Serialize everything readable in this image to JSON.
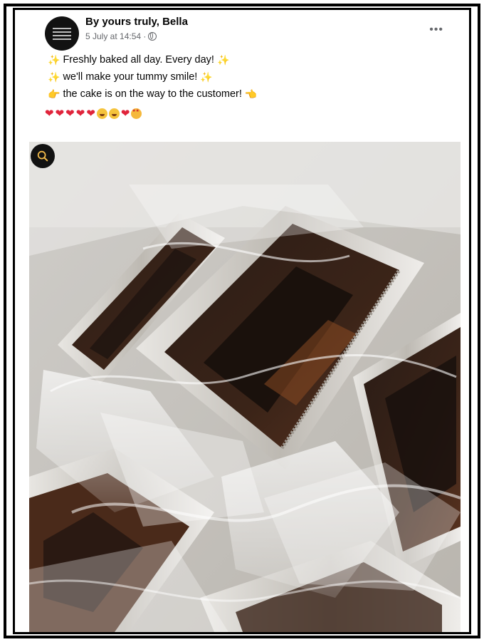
{
  "post": {
    "author": "By yours truly, Bella",
    "timestamp": "5 July at 14:54 · ",
    "more_label": "•••",
    "lines": [
      "Freshly baked all day. Every day!",
      "we'll make your tummy smile!",
      "the cake is on the way to the customer!"
    ]
  },
  "colors": {
    "frame": "#000000",
    "avatar_bg": "#121212",
    "heart": "#e0243b",
    "text": "#050505",
    "meta": "#65676b"
  },
  "icons": [
    "globe-icon",
    "more-options-icon",
    "sparkles-icon",
    "pointing-hand-icon",
    "zoom-icon",
    "red-heart-emoji",
    "laughing-emoji",
    "star-struck-emoji"
  ]
}
